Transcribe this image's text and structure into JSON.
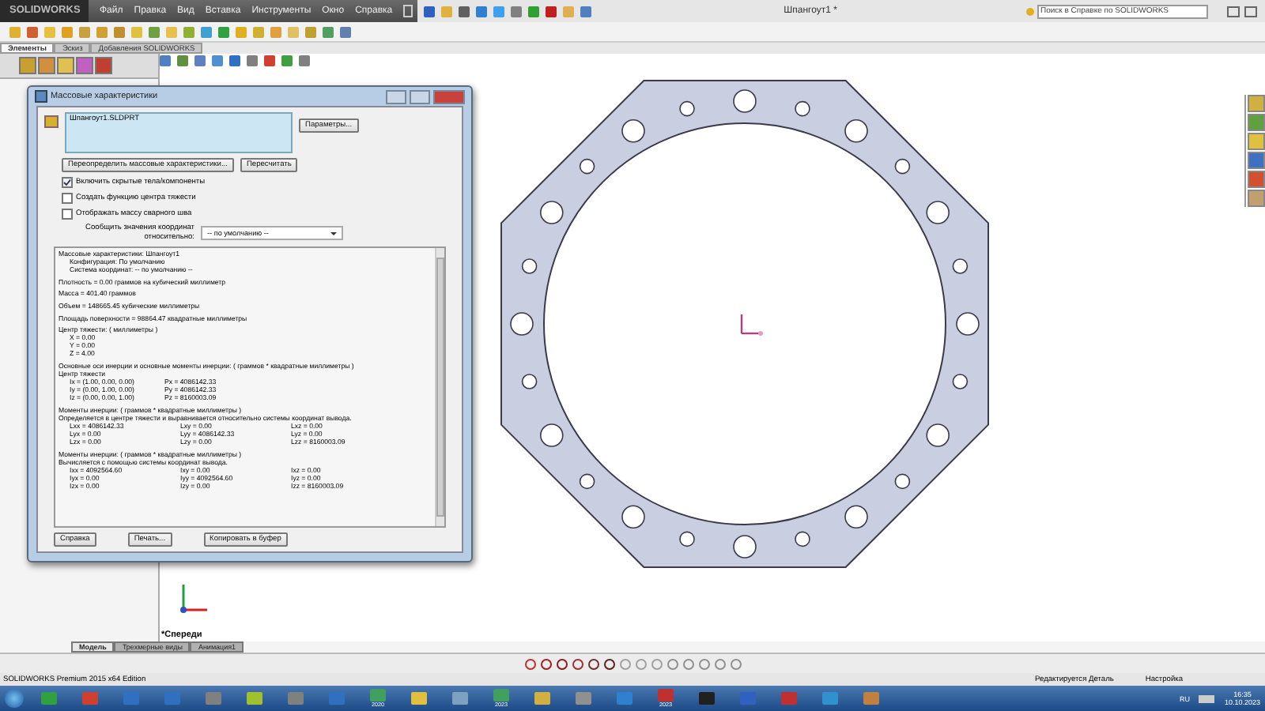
{
  "app": {
    "logo": "SOLIDWORKS",
    "menu": [
      "Файл",
      "Правка",
      "Вид",
      "Вставка",
      "Инструменты",
      "Окно",
      "Справка"
    ],
    "title": "Шпангоут1 *",
    "search": {
      "placeholder": "Поиск в Справке по SOLIDWORKS"
    }
  },
  "command_tabs": [
    {
      "label": "Элементы",
      "selected": true
    },
    {
      "label": "Эскиз",
      "selected": false
    },
    {
      "label": "Добавления SOLIDWORKS",
      "selected": false
    }
  ],
  "dialog": {
    "title": "Массовые характеристики",
    "file": "Шпангоут1.SLDPRT",
    "buttons_top": [
      "Параметры...",
      "Переопределить массовые характеристики...",
      "Пересчитать"
    ],
    "checkboxes": [
      {
        "label": "Включить скрытые тела/компоненты",
        "checked": true
      },
      {
        "label": "Создать функцию центра тяжести",
        "checked": false
      },
      {
        "label": "Отображать массу сварного шва",
        "checked": false
      }
    ],
    "coord_label": [
      "Сообщить значения координат",
      "относительно:"
    ],
    "coord_value": "-- по умолчанию --",
    "results": [
      [
        {
          "kind": "line",
          "text": "Массовые характеристики: Шпангоут1"
        },
        {
          "kind": "sub",
          "text": "Конфигурация: По умолчанию"
        },
        {
          "kind": "sub",
          "text": "Система координат: -- по умолчанию --"
        }
      ],
      [
        {
          "kind": "line",
          "text": "Плотность = 0.00 граммов на кубический миллиметр"
        }
      ],
      [
        {
          "kind": "line",
          "text": "Масса = 401.40 граммов"
        }
      ],
      [
        {
          "kind": "line",
          "text": "Объем = 148665.45 кубические миллиметры"
        }
      ],
      [
        {
          "kind": "line",
          "text": "Площадь поверхности = 98864.47  квадратные миллиметры"
        }
      ],
      [
        {
          "kind": "line",
          "text": "Центр тяжести: ( миллиметры )"
        },
        {
          "kind": "sub",
          "text": "X = 0.00"
        },
        {
          "kind": "sub",
          "text": "Y = 0.00"
        },
        {
          "kind": "sub",
          "text": "Z = 4.00"
        }
      ],
      [
        {
          "kind": "line",
          "text": "Основные оси инерции и основные моменты инерции: ( граммов *  квадратные миллиметры )"
        },
        {
          "kind": "line",
          "text": "Центр тяжести"
        },
        {
          "kind": "row",
          "cells": [
            "Ix = (1.00,  0.00,  0.00)",
            "Px = 4086142.33"
          ]
        },
        {
          "kind": "row",
          "cells": [
            "Iy = (0.00,  1.00,  0.00)",
            "Py = 4086142.33"
          ]
        },
        {
          "kind": "row",
          "cells": [
            "Iz = (0.00,  0.00,  1.00)",
            "Pz = 8160003.09"
          ]
        }
      ],
      [
        {
          "kind": "line",
          "text": "Моменты инерции: ( граммов *  квадратные миллиметры )"
        },
        {
          "kind": "line",
          "text": "Определяется в центре тяжести и выравнивается относительно системы координат вывода."
        },
        {
          "kind": "row",
          "cells": [
            "Lxx = 4086142.33",
            "Lxy = 0.00",
            "Lxz = 0.00"
          ]
        },
        {
          "kind": "row",
          "cells": [
            "Lyx = 0.00",
            "Lyy = 4086142.33",
            "Lyz = 0.00"
          ]
        },
        {
          "kind": "row",
          "cells": [
            "Lzx = 0.00",
            "Lzy = 0.00",
            "Lzz = 8160003.09"
          ]
        }
      ],
      [
        {
          "kind": "line",
          "text": "Моменты инерции: ( граммов *  квадратные миллиметры )"
        },
        {
          "kind": "line",
          "text": "Вычисляется с помощью системы координат вывода."
        },
        {
          "kind": "row",
          "cells": [
            "Ixx = 4092564.60",
            "Ixy = 0.00",
            "Ixz = 0.00"
          ]
        },
        {
          "kind": "row",
          "cells": [
            "Iyx = 0.00",
            "Iyy = 4092564.60",
            "Iyz = 0.00"
          ]
        },
        {
          "kind": "row",
          "cells": [
            "Izx = 0.00",
            "Izy = 0.00",
            "Izz = 8160003.09"
          ]
        }
      ]
    ],
    "buttons_bottom": [
      "Справка",
      "Печать...",
      "Копировать в буфер"
    ]
  },
  "view_label": "*Спереди",
  "model_tabs": [
    {
      "label": "Модель",
      "selected": true
    },
    {
      "label": "Трехмерные виды",
      "selected": false
    },
    {
      "label": "Анимация1",
      "selected": false
    }
  ],
  "status_bar": {
    "edition": "SOLIDWORKS Premium 2015 x64 Edition",
    "mode": "Редактируется Деталь",
    "settings": "Настройка"
  },
  "taskbar": {
    "apps": [
      {
        "kind": "plain"
      },
      {
        "kind": "plain"
      },
      {
        "kind": "plain"
      },
      {
        "kind": "plain"
      },
      {
        "kind": "plain"
      },
      {
        "kind": "plain"
      },
      {
        "kind": "plain"
      },
      {
        "kind": "plain"
      },
      {
        "kind": "versioned",
        "label": "2020"
      },
      {
        "kind": "plain"
      },
      {
        "kind": "plain"
      },
      {
        "kind": "versioned",
        "label": "2023"
      },
      {
        "kind": "plain"
      },
      {
        "kind": "plain"
      },
      {
        "kind": "plain"
      },
      {
        "kind": "versioned",
        "label": "2023"
      },
      {
        "kind": "plain"
      },
      {
        "kind": "plain"
      },
      {
        "kind": "plain"
      },
      {
        "kind": "plain"
      },
      {
        "kind": "plain"
      }
    ],
    "language": "RU",
    "time": "16:35",
    "date": "10.10.2023"
  }
}
